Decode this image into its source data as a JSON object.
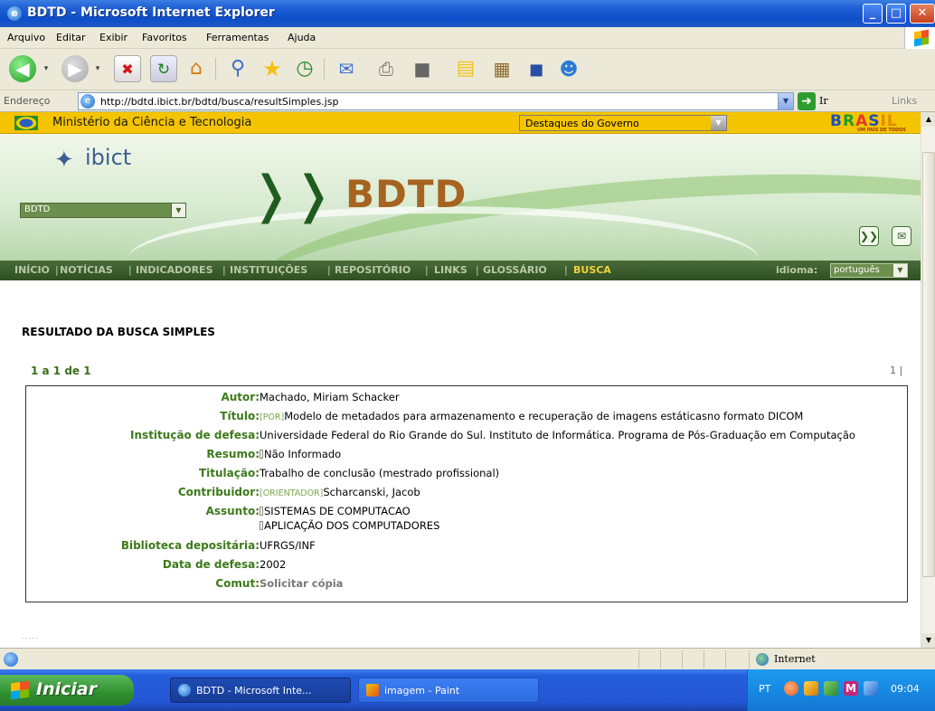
{
  "window": {
    "title": "BDTD - Microsoft Internet Explorer"
  },
  "menubar": {
    "items": [
      "Arquivo",
      "Editar",
      "Exibir",
      "Favoritos",
      "Ferramentas",
      "Ajuda"
    ]
  },
  "toolbar": {
    "icons": [
      "back-icon",
      "forward-icon",
      "stop-icon",
      "refresh-icon",
      "home-icon",
      "search-icon",
      "favorites-icon",
      "history-icon",
      "mail-icon",
      "print-icon",
      "edit-icon",
      "notes-icon",
      "research-icon",
      "messenger-icon",
      "people-icon"
    ]
  },
  "address": {
    "label": "Endereço",
    "url": "http://bdtd.ibict.br/bdtd/busca/resultSimples.jsp",
    "go_label": "Ir",
    "links_label": "Links"
  },
  "gov_bar": {
    "ministry": "Ministério da Ciência e Tecnologia",
    "highlights_select": "Destaques do Governo",
    "brasil_logo": "BRASIL",
    "brasil_tagline": "UM PAÍS DE TODOS"
  },
  "banner": {
    "ibict_logo": "ibict",
    "site_select": "BDTD",
    "title": "BDTD"
  },
  "nav": {
    "items": [
      {
        "label": "INÍCIO",
        "active": false
      },
      {
        "label": "NOTÍCIAS",
        "active": false
      },
      {
        "label": "INDICADORES",
        "active": false
      },
      {
        "label": "INSTITUIÇÕES",
        "active": false
      },
      {
        "label": "REPOSITÓRIO",
        "active": false
      },
      {
        "label": "LINKS",
        "active": false
      },
      {
        "label": "GLOSSÁRIO",
        "active": false
      },
      {
        "label": "BUSCA",
        "active": true
      }
    ],
    "language_label": "idioma:",
    "language_value": "português"
  },
  "results": {
    "heading": "RESULTADO DA BUSCA SIMPLES",
    "pager": "1 a 1 de 1",
    "page_links": "1 |",
    "record": {
      "autor_label": "Autor:",
      "autor": "Machado, Miriam Schacker",
      "titulo_label": "Título:",
      "titulo_tag": "[POR]",
      "titulo": "Modelo de metadados para armazenamento e recuperação de imagens estáticasno formato DICOM",
      "instituicao_label": "Institução de defesa:",
      "instituicao": "Universidade Federal do Rio Grande do Sul. Instituto de Informática. Programa de Pós-Graduação em Computação",
      "resumo_label": "Resumo:",
      "resumo": "Não Informado",
      "titulacao_label": "Titulação:",
      "titulacao": "Trabalho de conclusão (mestrado profissional)",
      "contribuidor_label": "Contribuidor:",
      "contribuidor_tag": "[ORIENTADOR]",
      "contribuidor": "Scharcanski, Jacob",
      "assunto_label": "Assunto:",
      "assunto": [
        "SISTEMAS DE COMPUTACAO",
        "APLICAÇÃO DOS COMPUTADORES"
      ],
      "biblioteca_label": "Biblioteca depositária:",
      "biblioteca": "UFRGS/INF",
      "data_label": "Data de defesa:",
      "data": "2002",
      "comut_label": "Comut:",
      "comut": "Solicitar cópia"
    }
  },
  "statusbar": {
    "zone": "Internet"
  },
  "taskbar": {
    "start_label": "Iniciar",
    "tasks": [
      "BDTD - Microsoft Inte...",
      "imagem - Paint"
    ],
    "language": "PT",
    "clock": "09:04"
  }
}
